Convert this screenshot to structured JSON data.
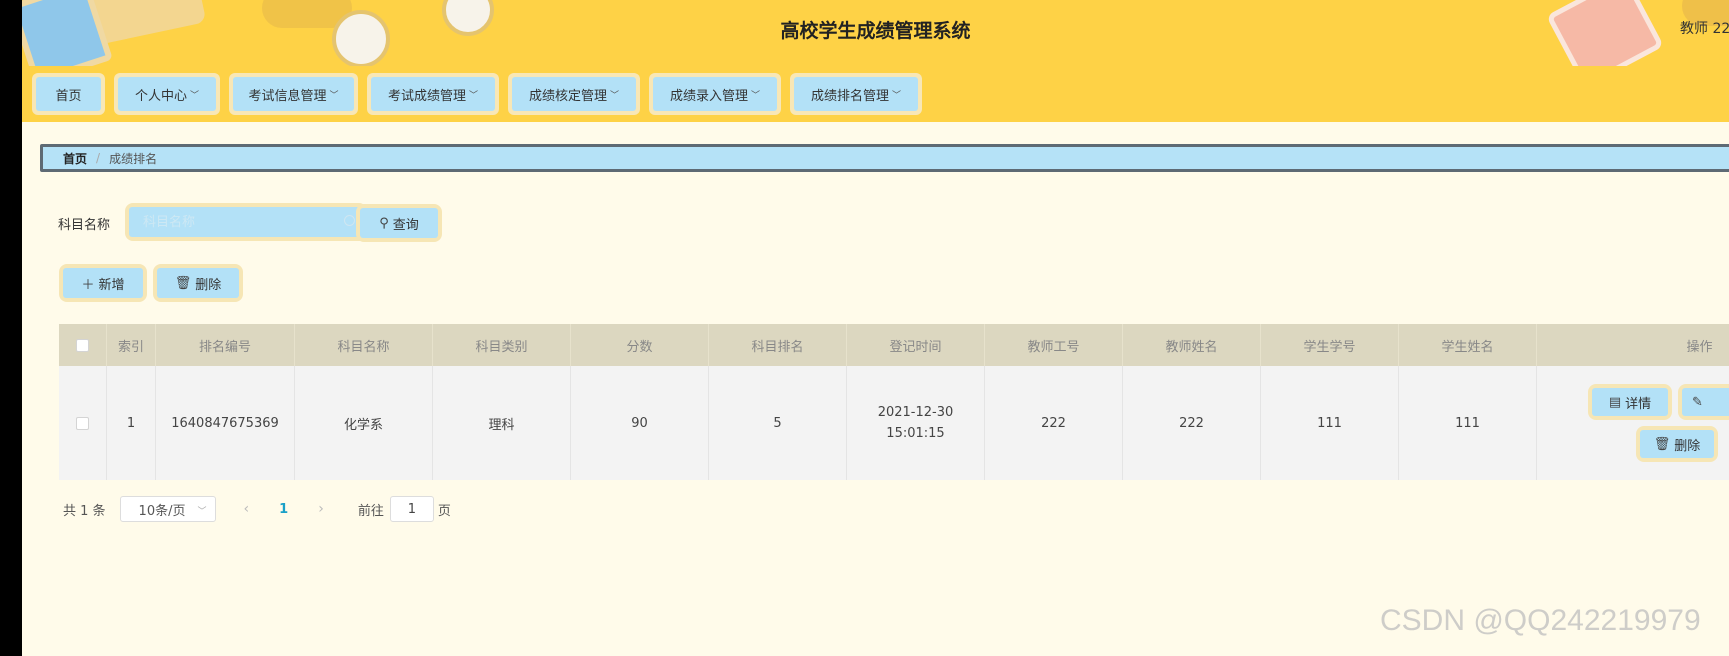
{
  "header": {
    "title": "高校学生成绩管理系统",
    "user": "教师 22"
  },
  "nav": [
    {
      "label": "首页",
      "dropdown": false
    },
    {
      "label": "个人中心",
      "dropdown": true
    },
    {
      "label": "考试信息管理",
      "dropdown": true
    },
    {
      "label": "考试成绩管理",
      "dropdown": true
    },
    {
      "label": "成绩核定管理",
      "dropdown": true
    },
    {
      "label": "成绩录入管理",
      "dropdown": true
    },
    {
      "label": "成绩排名管理",
      "dropdown": true
    }
  ],
  "breadcrumb": {
    "home": "首页",
    "separator": "/",
    "current": "成绩排名"
  },
  "search": {
    "label": "科目名称",
    "placeholder": "科目名称",
    "value": "",
    "button": "查询"
  },
  "actions": {
    "add": "新增",
    "delete": "删除"
  },
  "table": {
    "columns": [
      "索引",
      "排名编号",
      "科目名称",
      "科目类别",
      "分数",
      "科目排名",
      "登记时间",
      "教师工号",
      "教师姓名",
      "学生学号",
      "学生姓名",
      "操作"
    ],
    "rows": [
      {
        "index": "1",
        "rank_no": "1640847675369",
        "subject": "化学系",
        "category": "理科",
        "score": "90",
        "subject_rank": "5",
        "time": "2021-12-30 15:01:15",
        "teacher_id": "222",
        "teacher_name": "222",
        "student_id": "111",
        "student_name": "111",
        "ops": {
          "detail": "详情",
          "delete": "删除"
        }
      }
    ]
  },
  "pagination": {
    "total": "共 1 条",
    "page_size": "10条/页",
    "current_page": "1",
    "goto_label": "前往",
    "goto_value": "1",
    "page_suffix": "页"
  },
  "watermark": "CSDN @QQ242219979",
  "colors": {
    "header_bg": "#fed246",
    "button_bg": "#b3e1f7",
    "button_border": "#f6e6b5",
    "page_bg": "#fffbea",
    "table_header": "#dcd7c0"
  }
}
